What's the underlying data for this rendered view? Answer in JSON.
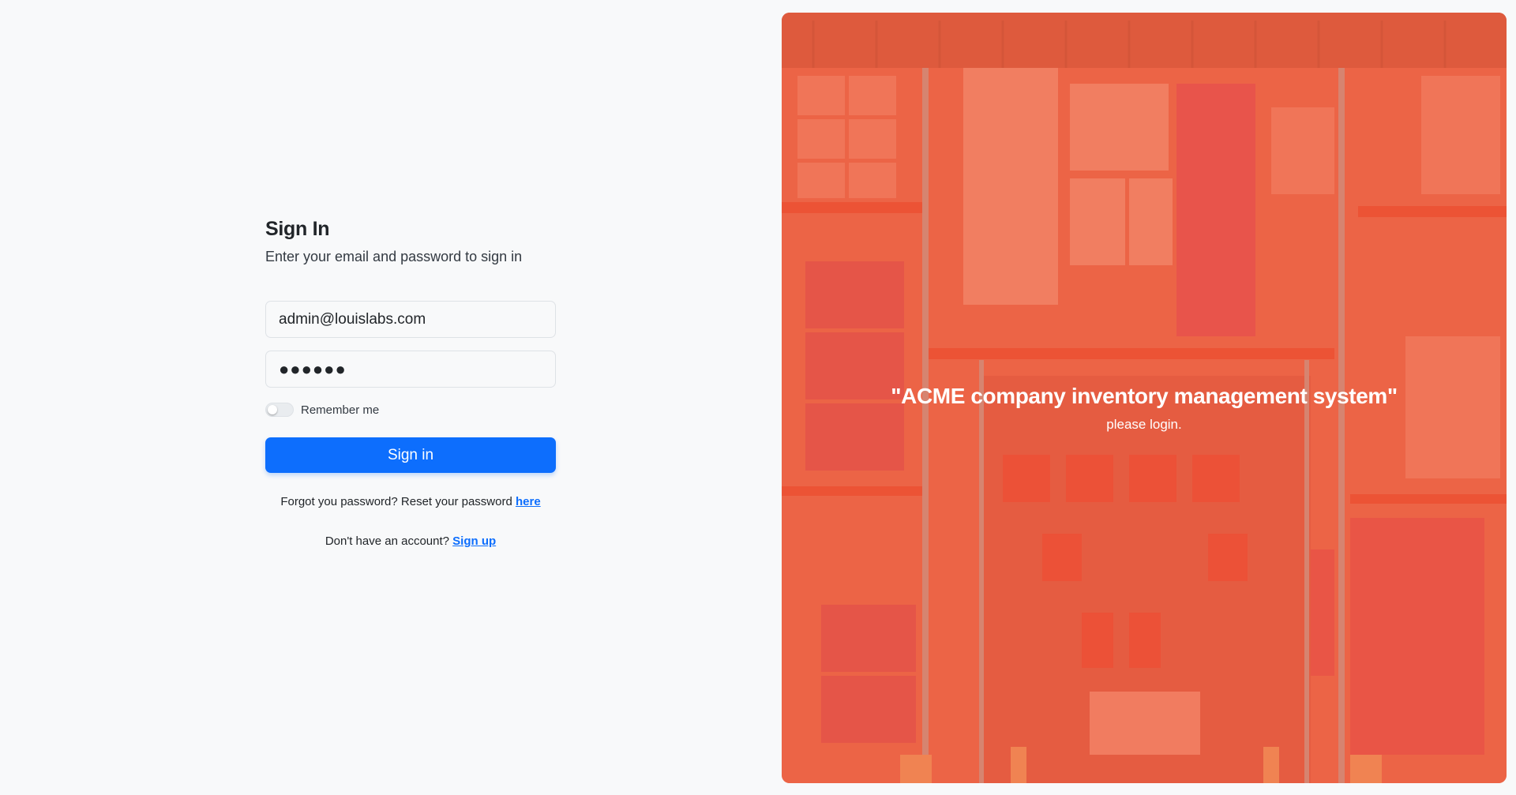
{
  "signin": {
    "title": "Sign In",
    "subtitle": "Enter your email and password to sign in",
    "email_value": "admin@louislabs.com",
    "password_value": "●●●●●●",
    "remember_label": "Remember me",
    "remember_checked": false,
    "button_label": "Sign in",
    "forgot_text": "Forgot you password? Reset your password ",
    "forgot_link": "here",
    "signup_text": "Don't have an account? ",
    "signup_link": "Sign up"
  },
  "hero": {
    "title": "\"ACME company inventory management system\"",
    "subtitle": "please login.",
    "overlay_color": "#ee5f3e",
    "image_subject": "warehouse shelving with boxes"
  },
  "colors": {
    "accent": "#0d6efd",
    "background": "#f8f9fa"
  }
}
